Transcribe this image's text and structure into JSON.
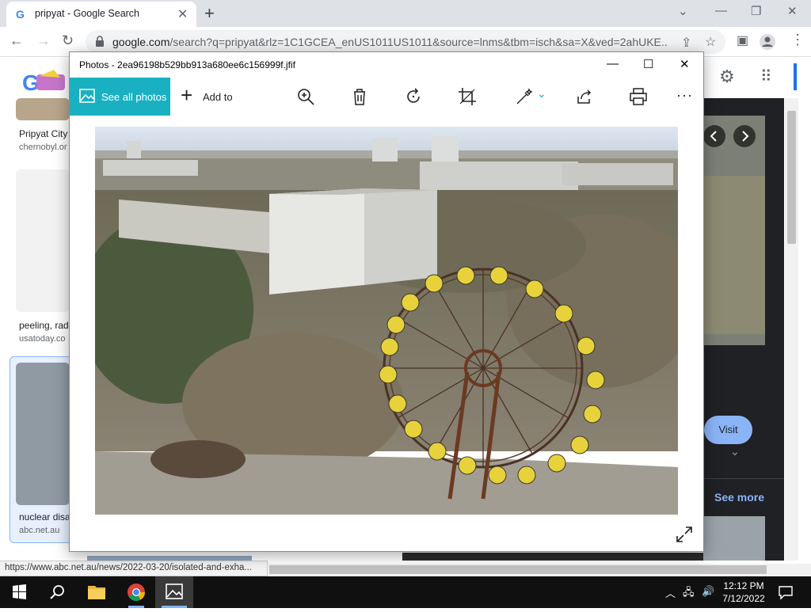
{
  "browser": {
    "tab_title": "pripyat - Google Search",
    "url_host": "google.com",
    "url_rest": "/search?q=pripyat&rlz=1C1GCEA_enUS1011US1011&source=lnms&tbm=isch&sa=X&ved=2ahUKE...",
    "status_url": "https://www.abc.net.au/news/2022-03-20/isolated-and-exha..."
  },
  "google": {
    "results": [
      {
        "title": "Pripyat City",
        "source": "chernobyl.or"
      },
      {
        "title": "peeling, rad",
        "source": "usatoday.co"
      },
      {
        "title": "nuclear disa",
        "source": "abc.net.au"
      }
    ],
    "visit_label": "Visit",
    "see_more_label": "See more"
  },
  "photos": {
    "title": "Photos - 2ea96198b529bb913a680ee6c156999f.jfif",
    "see_all_label": "See all photos",
    "add_to_label": "Add to"
  },
  "taskbar": {
    "time": "12:12 PM",
    "date": "7/12/2022"
  },
  "colors": {
    "photos_accent": "#19b1c2",
    "google_link": "#8ab4f8"
  }
}
